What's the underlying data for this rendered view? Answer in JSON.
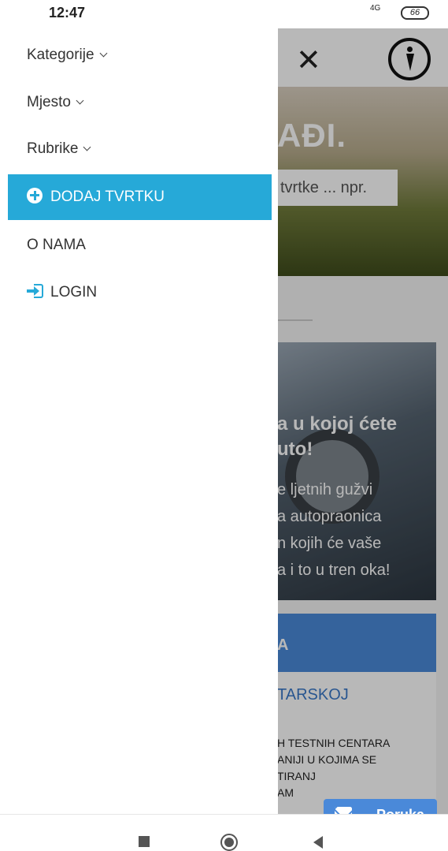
{
  "status_bar": {
    "time": "12:47",
    "network": "4G",
    "battery": "66"
  },
  "background_page": {
    "hero_text": "AĐI.",
    "search_placeholder": "tvrtke ... npr.",
    "article_title": "a u kojoj ćete\nuto!",
    "article_text": "e ljetnih gužvi\na autopraonica\nn kojih će vaše\na i to u tren oka!",
    "card_header": "A",
    "card_subtitle": "TARSKOJ",
    "card_text": "H TESTNIH CENTARA\nANIJI U KOJIMA SE\nTIRANJ\nAM",
    "fab_label": "Poruka"
  },
  "drawer": {
    "items": [
      {
        "label": "Kategorije"
      },
      {
        "label": "Mjesto"
      },
      {
        "label": "Rubrike"
      },
      {
        "label": "DODAJ TVRTKU"
      },
      {
        "label": "O NAMA"
      },
      {
        "label": "LOGIN"
      }
    ]
  },
  "colors": {
    "accent": "#26a9d8",
    "card_blue": "#4a89d9"
  },
  "icons": {
    "close": "close-icon",
    "logo": "info-logo-icon",
    "plus": "plus-circle-icon",
    "login": "login-icon",
    "mail": "mail-icon",
    "chevron": "chevron-down-icon"
  }
}
